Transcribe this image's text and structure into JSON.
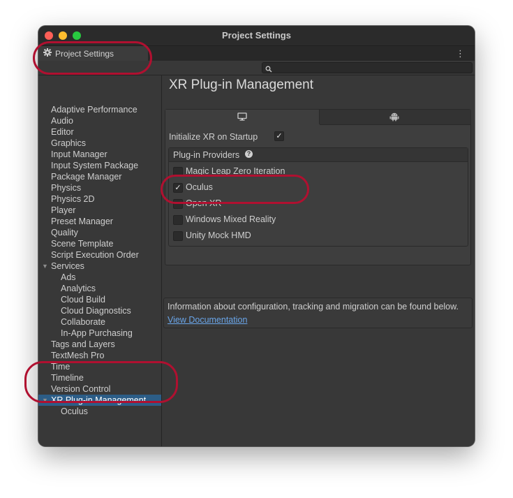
{
  "window": {
    "title": "Project Settings",
    "tab_label": "Project Settings",
    "menu_glyph": "⋮",
    "search": {
      "value": "",
      "placeholder": ""
    }
  },
  "sidebar": {
    "items": [
      {
        "label": "Adaptive Performance",
        "level": 0
      },
      {
        "label": "Audio",
        "level": 0
      },
      {
        "label": "Editor",
        "level": 0
      },
      {
        "label": "Graphics",
        "level": 0
      },
      {
        "label": "Input Manager",
        "level": 0
      },
      {
        "label": "Input System Package",
        "level": 0
      },
      {
        "label": "Package Manager",
        "level": 0
      },
      {
        "label": "Physics",
        "level": 0
      },
      {
        "label": "Physics 2D",
        "level": 0
      },
      {
        "label": "Player",
        "level": 0
      },
      {
        "label": "Preset Manager",
        "level": 0
      },
      {
        "label": "Quality",
        "level": 0
      },
      {
        "label": "Scene Template",
        "level": 0
      },
      {
        "label": "Script Execution Order",
        "level": 0
      },
      {
        "label": "Services",
        "level": 0,
        "expanded": true
      },
      {
        "label": "Ads",
        "level": 1
      },
      {
        "label": "Analytics",
        "level": 1
      },
      {
        "label": "Cloud Build",
        "level": 1
      },
      {
        "label": "Cloud Diagnostics",
        "level": 1
      },
      {
        "label": "Collaborate",
        "level": 1
      },
      {
        "label": "In-App Purchasing",
        "level": 1
      },
      {
        "label": "Tags and Layers",
        "level": 0
      },
      {
        "label": "TextMesh Pro",
        "level": 0
      },
      {
        "label": "Time",
        "level": 0
      },
      {
        "label": "Timeline",
        "level": 0
      },
      {
        "label": "Version Control",
        "level": 0
      },
      {
        "label": "XR Plug-in Management",
        "level": 0,
        "expanded": true,
        "selected": true
      },
      {
        "label": "Oculus",
        "level": 1
      }
    ]
  },
  "main": {
    "heading": "XR Plug-in Management",
    "platform_tabs": [
      {
        "icon": "desktop-icon",
        "active": true
      },
      {
        "icon": "android-icon",
        "active": false
      }
    ],
    "initialize_label": "Initialize XR on Startup",
    "initialize_checked": true,
    "providers_title": "Plug-in Providers",
    "help_glyph": "?",
    "providers": [
      {
        "label": "Magic Leap Zero Iteration",
        "checked": false
      },
      {
        "label": "Oculus",
        "checked": true
      },
      {
        "label": "Open XR",
        "checked": false
      },
      {
        "label": "Windows Mixed Reality",
        "checked": false
      },
      {
        "label": "Unity Mock HMD",
        "checked": false
      }
    ],
    "info_text": "Information about configuration, tracking and migration can be found below.",
    "info_link": "View Documentation"
  },
  "check_glyph": "✓",
  "colors": {
    "selection": "#2c5d87",
    "link": "#6aa6ea",
    "annotation": "#b01030"
  }
}
